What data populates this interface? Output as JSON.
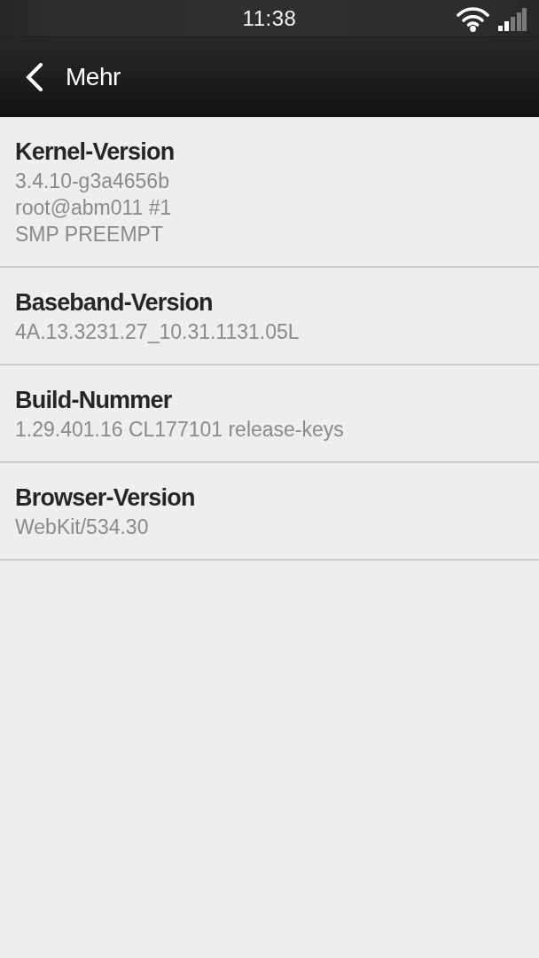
{
  "status_bar": {
    "time": "11:38"
  },
  "action_bar": {
    "title": "Mehr"
  },
  "items": [
    {
      "title": "Kernel-Version",
      "value_lines": [
        "3.4.10-g3a4656b",
        "root@abm011 #1",
        "SMP PREEMPT"
      ]
    },
    {
      "title": "Baseband-Version",
      "value_lines": [
        "4A.13.3231.27_10.31.1131.05L"
      ]
    },
    {
      "title": "Build-Nummer",
      "value_lines": [
        "1.29.401.16 CL177101 release-keys"
      ]
    },
    {
      "title": "Browser-Version",
      "value_lines": [
        "WebKit/534.30"
      ]
    }
  ]
}
